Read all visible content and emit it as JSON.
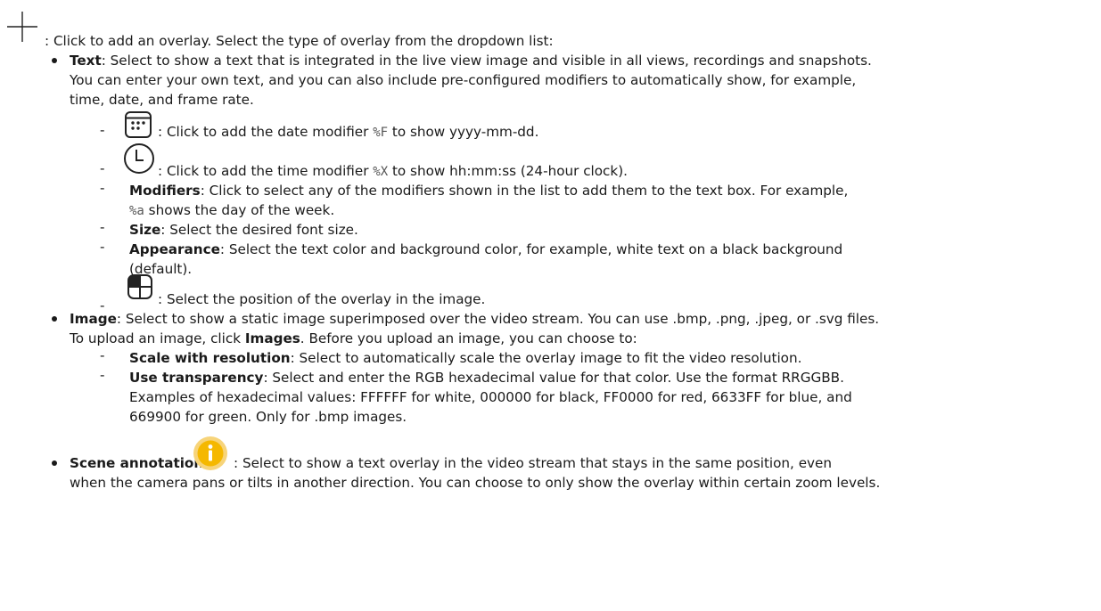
{
  "intro": {
    "text": ": Click to add an overlay. Select the type of overlay from the dropdown list:",
    "icon": "plus-icon"
  },
  "text_item": {
    "label": "Text",
    "line1": ": Select to show a text that is integrated in the live view image and visible in all views, recordings and snapshots.",
    "line2": "You can enter your own text, and you can also include pre-configured modifiers to automatically show, for example,",
    "line3": "time, date, and frame rate.",
    "date": {
      "icon": "calendar-icon",
      "before": ": Click to add the date modifier ",
      "code": "%F",
      "after": " to show yyyy-mm-dd."
    },
    "time": {
      "icon": "clock-icon",
      "before": ": Click to add the time modifier ",
      "code": "%X",
      "after": " to show hh:mm:ss (24-hour clock)."
    },
    "modifiers": {
      "label": "Modifiers",
      "line1": ": Click to select any of the modifiers shown in the list to add them to the text box. For example,",
      "code": "%a",
      "line2": " shows the day of the week."
    },
    "size": {
      "label": "Size",
      "text": ": Select the desired font size."
    },
    "appearance": {
      "label": "Appearance",
      "line1": ": Select the text color and background color, for example, white text on a black background",
      "line2": "(default)."
    },
    "position": {
      "icon": "position-grid-icon",
      "text": ": Select the position of the overlay in the image."
    }
  },
  "image_item": {
    "label": "Image",
    "line1": ": Select to show a static image superimposed over the video stream. You can use .bmp, .png, .jpeg, or .svg files.",
    "line2_before": "To upload an image, click ",
    "line2_bold": "Images",
    "line2_after": ". Before you upload an image, you can choose to:",
    "scale": {
      "label": "Scale with resolution",
      "text": ": Select to automatically scale the overlay image to fit the video resolution."
    },
    "transparency": {
      "label": "Use transparency",
      "line1": ": Select and enter the RGB hexadecimal value for that color. Use the format RRGGBB.",
      "line2": "Examples of hexadecimal values: FFFFFF for white, 000000 for black, FF0000 for red, 6633FF for blue, and",
      "line3": "669900 for green. Only for .bmp images."
    }
  },
  "scene_item": {
    "label": "Scene annotation",
    "icon": "info-icon",
    "line1": ": Select to show a text overlay in the video stream that stays in the same position, even",
    "line2": "when the camera pans or tilts in another direction. You can choose to only show the overlay within certain zoom levels.",
    "accent": "#f5b800"
  }
}
